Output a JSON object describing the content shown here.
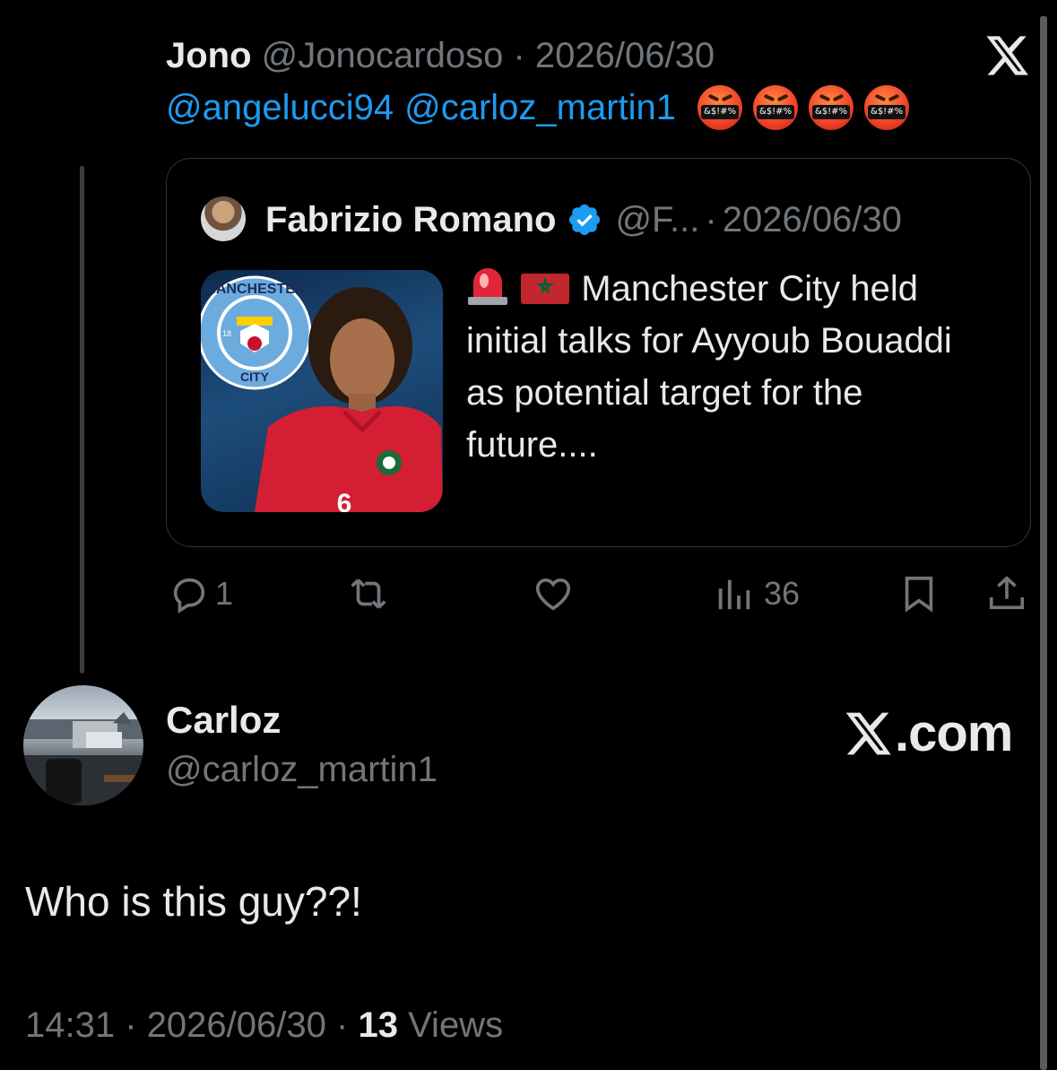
{
  "parent_tweet": {
    "name": "Jono",
    "handle": "@Jonocardoso",
    "separator": "·",
    "date": "2026/06/30",
    "mentions": [
      "@angelucci94",
      "@carloz_martin1"
    ],
    "emoji_text": "&$!#%",
    "emoji_name": "face-with-symbols-on-mouth-icon",
    "stats": {
      "replies": "1",
      "views": "36"
    }
  },
  "quoted_tweet": {
    "name": "Fabrizio Romano",
    "handle": "@F...",
    "separator": "·",
    "date": "2026/06/30",
    "text": "Manchester City held initial talks for Ayyoub Bouaddi as potential target for the future....",
    "thumbnail_badge_top": "MANCHESTER",
    "thumbnail_badge_bottom": "CITY",
    "thumbnail_badge_year": "18",
    "shirt_number": "6"
  },
  "reply_tweet": {
    "name": "Carloz",
    "handle": "@carloz_martin1",
    "text": "Who is this guy??!",
    "time": "14:31",
    "separator": "·",
    "date": "2026/06/30",
    "views_count": "13",
    "views_label": "Views"
  },
  "watermark": {
    "text": ".com"
  },
  "colors": {
    "background": "#000000",
    "accent": "#1d9bf0",
    "muted": "#71767b",
    "text": "#e7e9ea"
  }
}
